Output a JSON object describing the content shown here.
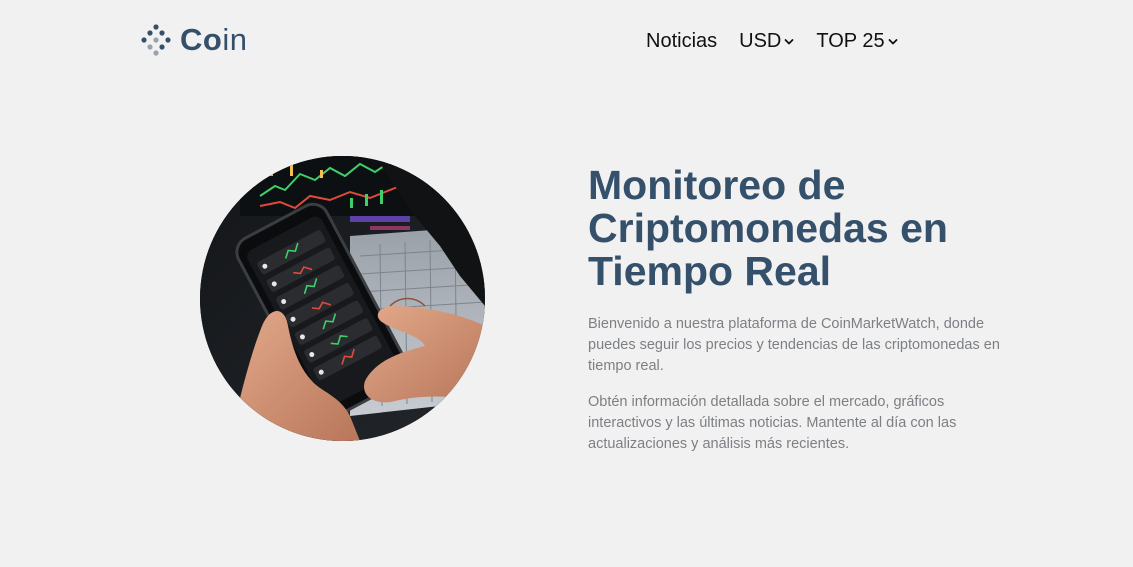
{
  "brand": {
    "name_strong": "Co",
    "name_rest": "in",
    "color": "#35506b",
    "icon": "dots-diamond-icon"
  },
  "nav": {
    "items": [
      {
        "label": "Noticias"
      },
      {
        "label": "USD",
        "icon": "chevron-down-icon"
      },
      {
        "label": "TOP 25",
        "icon": "chevron-down-icon"
      }
    ]
  },
  "hero": {
    "image": "phone-crypto-app-photo",
    "title": "Monitoreo de Criptomonedas en Tiempo Real",
    "paragraphs": [
      "Bienvenido a nuestra plataforma de CoinMarketWatch, donde puedes seguir los precios y tendencias de las criptomonedas en tiempo real.",
      "Obtén información detallada sobre el mercado, gráficos interactivos y las últimas noticias. Mantente al día con las actualizaciones y análisis más recientes."
    ]
  },
  "colors": {
    "background": "#f1f1f1",
    "heading": "#35506b",
    "body_text": "#7c7f84"
  }
}
